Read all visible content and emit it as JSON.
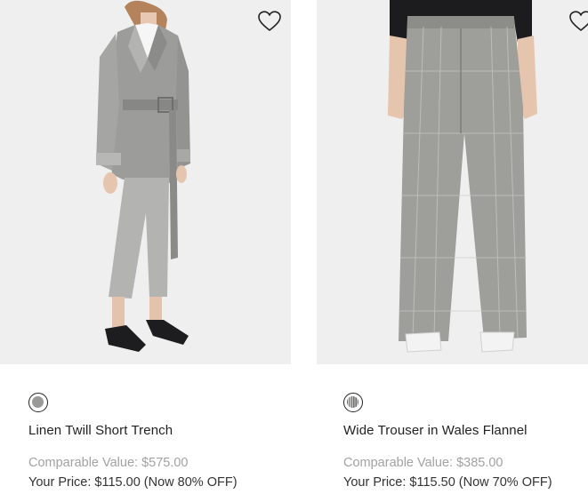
{
  "products": [
    {
      "name": "Linen Twill Short Trench",
      "comparable_value": "Comparable Value: $575.00",
      "your_price": "Your Price: $115.00 (Now 80% OFF)",
      "swatch_color": "#9a9a98",
      "wishlist_icon": "heart-outline-icon"
    },
    {
      "name": "Wide Trouser in Wales Flannel",
      "comparable_value": "Comparable Value: $385.00",
      "your_price": "Your Price: $115.50 (Now 70% OFF)",
      "swatch_color": "#8c8c8a",
      "wishlist_icon": "heart-outline-icon"
    }
  ]
}
